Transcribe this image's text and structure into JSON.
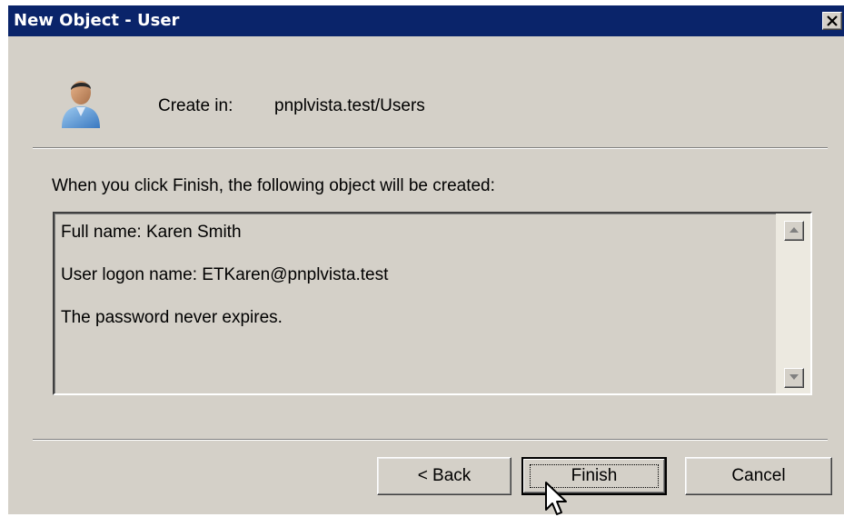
{
  "window": {
    "title": "New Object - User"
  },
  "header": {
    "icon": "user-icon",
    "create_in_label": "Create in:",
    "create_in_path": "pnplvista.test/Users"
  },
  "instruction": "When you click Finish, the following object will be created:",
  "summary": {
    "lines": [
      "Full name: Karen Smith",
      "User logon name: ETKaren@pnplvista.test",
      "The password never expires."
    ]
  },
  "buttons": {
    "back": "< Back",
    "finish": "Finish",
    "cancel": "Cancel"
  },
  "colors": {
    "titlebar": "#0a246a",
    "dialog_face": "#d4d0c8"
  }
}
